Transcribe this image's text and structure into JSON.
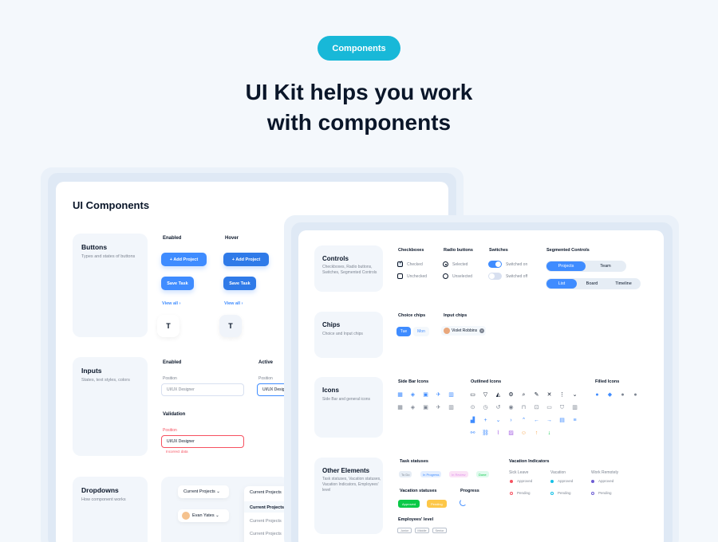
{
  "header": {
    "pill": "Components",
    "headline_line1": "UI Kit helps you work",
    "headline_line2": "with components"
  },
  "left_panel": {
    "title": "UI Components",
    "buttons_card": {
      "title": "Buttons",
      "desc": "Types and states of buttons",
      "enabled_label": "Enabled",
      "hover_label": "Hover",
      "add_project": "+  Add Project",
      "save_task": "Save Task",
      "view_all": "View all  ›",
      "icon_glyph": "T"
    },
    "inputs_card": {
      "title": "Inputs",
      "desc": "States, text styles, colors",
      "enabled_label": "Enabled",
      "active_label": "Active",
      "position_label": "Position",
      "placeholder": "UI/UX Designer",
      "active_value": "UI/UX Desig",
      "validation_label": "Validation",
      "validation_value": "UI/UX Designer",
      "error_text": "Incorrect data"
    },
    "dropdowns_card": {
      "title": "Dropdowns",
      "desc": "How component works",
      "dropdown1": "Current Projects  ⌄",
      "dropdown2": "Evan Yates  ⌄",
      "list": [
        "Current Projects",
        "Current Projects",
        "Current Projects",
        "Current Projects"
      ]
    }
  },
  "right_panel": {
    "controls": {
      "title": "Controls",
      "desc": "Checkboxes, Radio buttons, Switches, Segmented Controls",
      "checkboxes_label": "Checkboxes",
      "checked": "Checked",
      "unchecked": "Unchecked",
      "radio_label": "Radio buttons",
      "selected": "Selected",
      "unselected": "Unselected",
      "switches_label": "Switches",
      "switched_on": "Switched on",
      "switched_off": "Switched off",
      "segmented_label": "Segmented Controls",
      "seg1": [
        "Projects",
        "Team"
      ],
      "seg2": [
        "List",
        "Board",
        "Timeline"
      ]
    },
    "chips": {
      "title": "Chips",
      "desc": "Choice and Input chips",
      "choice_label": "Choice chips",
      "choice": [
        "Tue",
        "Mon"
      ],
      "input_label": "Input chips",
      "input_chip": "Violet Robbins"
    },
    "icons": {
      "title": "Icons",
      "desc": "Side Bar and general icons",
      "sidebar_label": "Side Bar Icons",
      "outlined_label": "Outlined Icons",
      "filled_label": "Filled Icons"
    },
    "other": {
      "title": "Other Elements",
      "desc": "Task statuses, Vacation statuses, Vacation Indicators, Employees' level",
      "task_label": "Task statuses",
      "tasks": [
        "To Do",
        "In Progress",
        "In Review",
        "Done"
      ],
      "vacation_status_label": "Vacation statuses",
      "vac_statuses": [
        "Approved",
        "Pending"
      ],
      "progress_label": "Progress",
      "indicators_label": "Vacation Indicators",
      "sick": "Sick Leave",
      "vacation": "Vacation",
      "remote": "Work Remotely",
      "approved": "Approved",
      "pending": "Pending",
      "level_label": "Employees' level",
      "levels": [
        "Junior",
        "Middle",
        "Senior"
      ]
    }
  },
  "colors": {
    "accent": "#3f8cff",
    "pill": "#18b8d8",
    "bg": "#f4f8fc",
    "error": "#f65160",
    "approved": "#0ac947",
    "pending": "#fdc748"
  }
}
